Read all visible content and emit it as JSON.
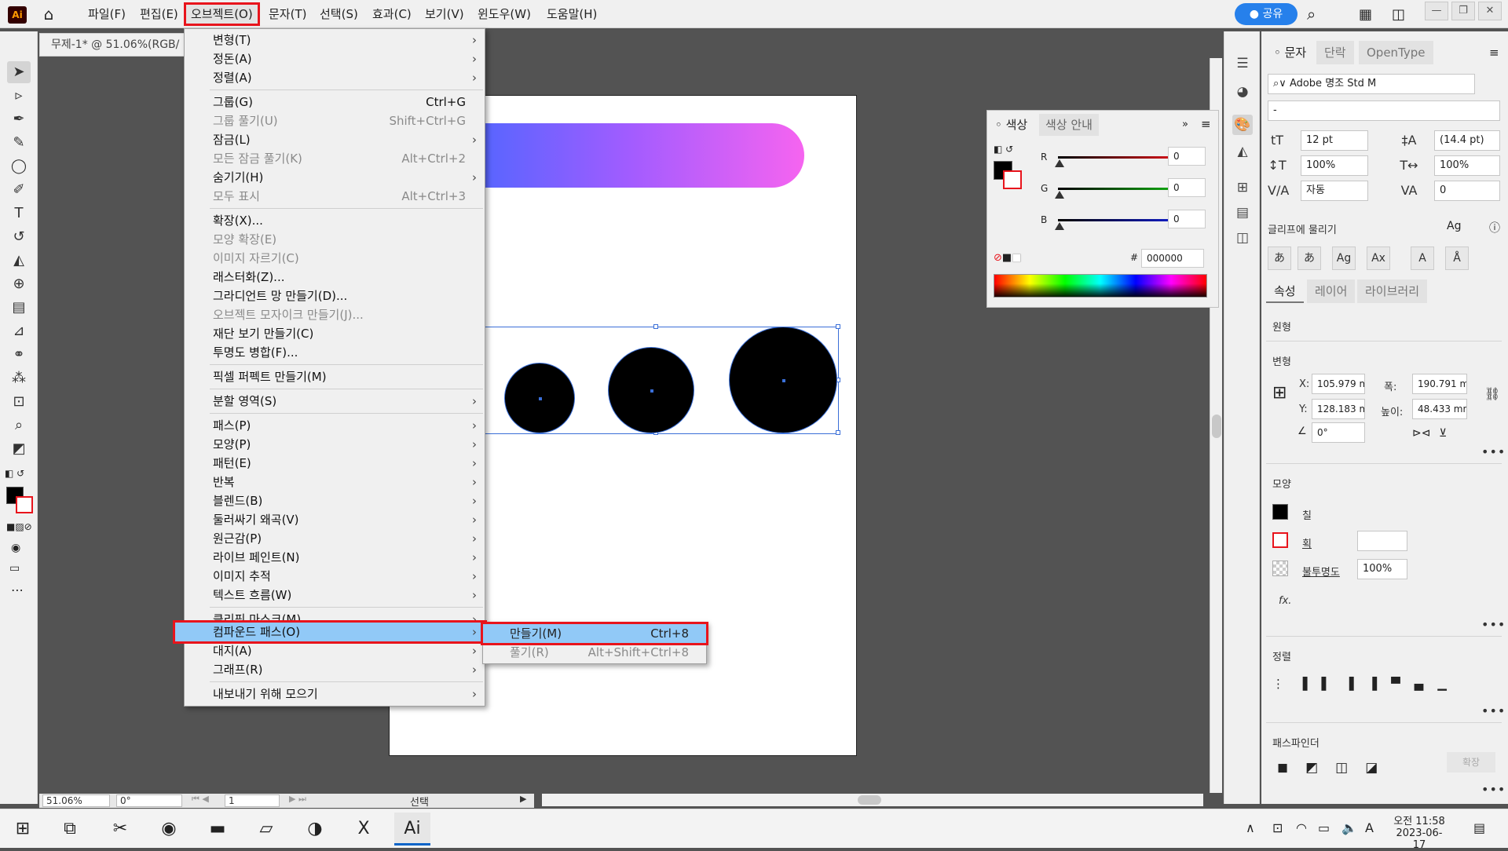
{
  "app": {
    "logo": "Ai",
    "share_label": "공유"
  },
  "menubar": {
    "items": [
      "파일(F)",
      "편집(E)",
      "오브젝트(O)",
      "문자(T)",
      "선택(S)",
      "효과(C)",
      "보기(V)",
      "윈도우(W)",
      "도움말(H)"
    ]
  },
  "document": {
    "tab_title": "무제-1* @ 51.06%(RGB/"
  },
  "object_menu": {
    "items": [
      {
        "label": "변형(T)",
        "submenu": true
      },
      {
        "label": "정돈(A)",
        "submenu": true
      },
      {
        "label": "정렬(A)",
        "submenu": true
      },
      {
        "label": "그룹(G)",
        "shortcut": "Ctrl+G"
      },
      {
        "label": "그룹 풀기(U)",
        "shortcut": "Shift+Ctrl+G",
        "disabled": true
      },
      {
        "label": "잠금(L)",
        "submenu": true
      },
      {
        "label": "모든 잠금 풀기(K)",
        "shortcut": "Alt+Ctrl+2",
        "disabled": true
      },
      {
        "label": "숨기기(H)",
        "submenu": true
      },
      {
        "label": "모두 표시",
        "shortcut": "Alt+Ctrl+3",
        "disabled": true
      },
      {
        "label": "확장(X)..."
      },
      {
        "label": "모양 확장(E)",
        "disabled": true
      },
      {
        "label": "이미지 자르기(C)",
        "disabled": true
      },
      {
        "label": "래스터화(Z)..."
      },
      {
        "label": "그라디언트 망 만들기(D)..."
      },
      {
        "label": "오브젝트 모자이크 만들기(J)...",
        "disabled": true
      },
      {
        "label": "재단 보기 만들기(C)"
      },
      {
        "label": "투명도 병합(F)..."
      },
      {
        "label": "픽셀 퍼펙트 만들기(M)"
      },
      {
        "label": "분할 영역(S)",
        "submenu": true
      },
      {
        "label": "패스(P)",
        "submenu": true
      },
      {
        "label": "모양(P)",
        "submenu": true
      },
      {
        "label": "패턴(E)",
        "submenu": true
      },
      {
        "label": "반복",
        "submenu": true
      },
      {
        "label": "블렌드(B)",
        "submenu": true
      },
      {
        "label": "둘러싸기 왜곡(V)",
        "submenu": true
      },
      {
        "label": "원근감(P)",
        "submenu": true
      },
      {
        "label": "라이브 페인트(N)",
        "submenu": true
      },
      {
        "label": "이미지 추적",
        "submenu": true
      },
      {
        "label": "텍스트 흐름(W)",
        "submenu": true
      },
      {
        "label": "클리핑 마스크(M)",
        "submenu": true
      },
      {
        "label": "컴파운드 패스(O)",
        "submenu": true
      },
      {
        "label": "대지(A)",
        "submenu": true
      },
      {
        "label": "그래프(R)",
        "submenu": true
      },
      {
        "label": "내보내기 위해 모으기",
        "submenu": true
      }
    ]
  },
  "compound_submenu": {
    "items": [
      {
        "label": "만들기(M)",
        "shortcut": "Ctrl+8"
      },
      {
        "label": "풀기(R)",
        "shortcut": "Alt+Shift+Ctrl+8",
        "disabled": true
      }
    ]
  },
  "color_panel": {
    "tabs": [
      "색상",
      "색상 안내"
    ],
    "channels": [
      {
        "name": "R",
        "value": "0",
        "color": "#e8141c"
      },
      {
        "name": "G",
        "value": "0",
        "color": "#14b814"
      },
      {
        "name": "B",
        "value": "0",
        "color": "#1420d8"
      }
    ],
    "hex_label": "#",
    "hex": "000000"
  },
  "char_panel": {
    "tabs": [
      "문자",
      "단락",
      "OpenType"
    ],
    "font": "Adobe 명조 Std M",
    "style": "-",
    "size": "12 pt",
    "leading": "(14.4 pt)",
    "v_scale": "100%",
    "h_scale": "100%",
    "kerning": "자동",
    "tracking": "0",
    "snap_glyph": "글리프에 물리기"
  },
  "props_panel": {
    "tabs": [
      "속성",
      "레이어",
      "라이브러리"
    ],
    "object_type": "원형",
    "transform_title": "변형",
    "x_label": "X:",
    "x": "105.979 m",
    "y_label": "Y:",
    "y": "128.183 m",
    "w_label": "폭:",
    "w": "190.791 m",
    "h_label": "높이:",
    "h": "48.433 mn",
    "angle": "0°",
    "appearance_title": "모양",
    "fill_label": "칠",
    "stroke_label": "획",
    "opacity_label": "불투명도",
    "opacity": "100%",
    "fx_label": "fx.",
    "align_title": "정렬",
    "pathfinder_title": "패스파인더",
    "expand_label": "확장"
  },
  "status": {
    "zoom": "51.06%",
    "rotate": "0°",
    "artboard": "1",
    "tool": "선택"
  },
  "taskbar": {
    "time": "오전 11:58",
    "date": "2023-06-17",
    "ime": "A"
  }
}
